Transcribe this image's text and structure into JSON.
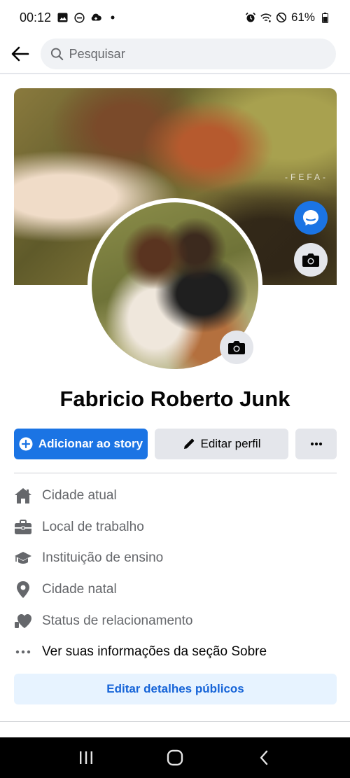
{
  "status_bar": {
    "time": "00:12",
    "battery": "61%"
  },
  "search": {
    "placeholder": "Pesquisar"
  },
  "cover": {
    "watermark": "-FEFA-"
  },
  "profile": {
    "name": "Fabricio Roberto Junk"
  },
  "actions": {
    "add_story": "Adicionar ao story",
    "edit_profile": "Editar perfil",
    "more": "···"
  },
  "details": [
    {
      "icon": "house-icon",
      "label": "Cidade atual"
    },
    {
      "icon": "briefcase-icon",
      "label": "Local de trabalho"
    },
    {
      "icon": "graduation-cap-icon",
      "label": "Instituição de ensino"
    },
    {
      "icon": "location-pin-icon",
      "label": "Cidade natal"
    },
    {
      "icon": "heart-icon",
      "label": "Status de relacionamento"
    },
    {
      "icon": "more-dots-icon",
      "label": "Ver suas informações da seção Sobre"
    }
  ],
  "edit_details": {
    "label": "Editar detalhes públicos"
  },
  "colors": {
    "primary": "#1b74e4",
    "secondary_bg": "#e4e6eb",
    "muted_text": "#65676b",
    "light_blue_bg": "#e7f3ff"
  }
}
